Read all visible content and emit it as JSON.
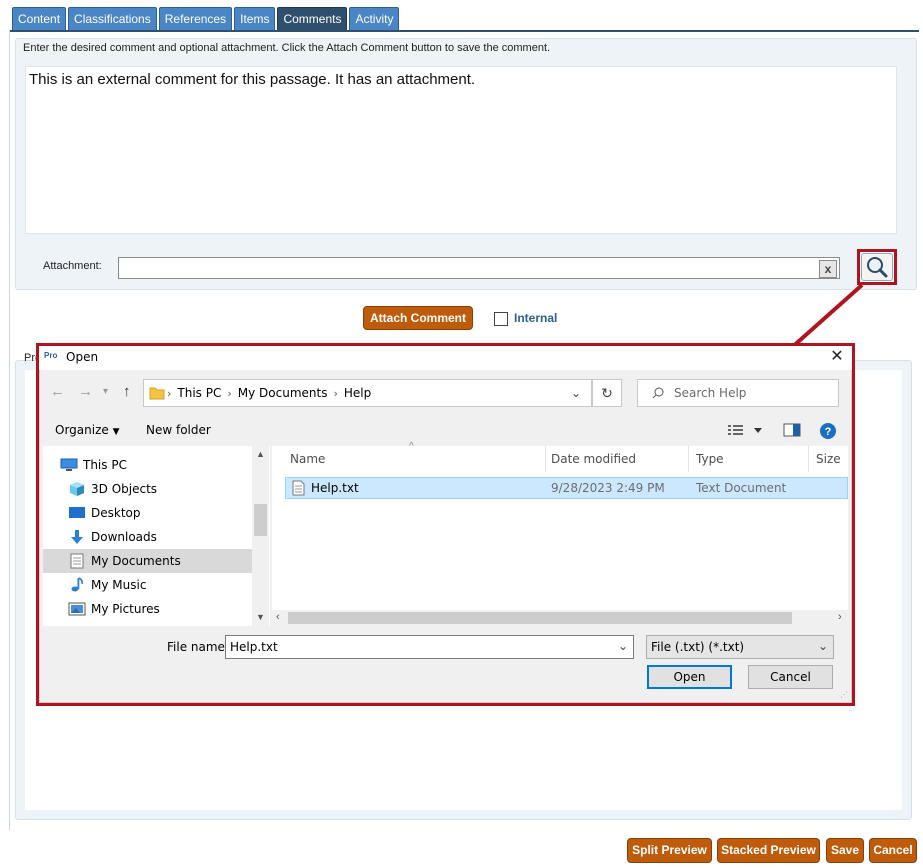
{
  "tabs": [
    {
      "label": "Content",
      "active": false
    },
    {
      "label": "Classifications",
      "active": false
    },
    {
      "label": "References",
      "active": false
    },
    {
      "label": "Items",
      "active": false
    },
    {
      "label": "Comments",
      "active": true
    },
    {
      "label": "Activity",
      "active": false
    }
  ],
  "comment_panel": {
    "instructions": "Enter the desired comment and optional attachment. Click the Attach Comment button to save the comment.",
    "comment_text": "This is an external comment for this passage.  It has an attachment.",
    "attachment_label": "Attachment:",
    "attachment_value": "",
    "clear_label": "x"
  },
  "actions": {
    "attach_comment": "Attach Comment",
    "internal_label": "Internal"
  },
  "preview": {
    "label": "Pre"
  },
  "dialog": {
    "title": "Open",
    "app_icon_text": "Pro",
    "close": "✕",
    "address": [
      "This PC",
      "My Documents",
      "Help"
    ],
    "search_placeholder": "Search Help",
    "toolbar": {
      "organize": "Organize",
      "new_folder": "New folder"
    },
    "nav_items": [
      {
        "label": "This PC",
        "icon": "computer-icon",
        "selected": false
      },
      {
        "label": "3D Objects",
        "icon": "cube-icon",
        "selected": false
      },
      {
        "label": "Desktop",
        "icon": "desktop-icon",
        "selected": false
      },
      {
        "label": "Downloads",
        "icon": "download-arrow-icon",
        "selected": false
      },
      {
        "label": "My Documents",
        "icon": "document-icon",
        "selected": true
      },
      {
        "label": "My Music",
        "icon": "music-note-icon",
        "selected": false
      },
      {
        "label": "My Pictures",
        "icon": "picture-icon",
        "selected": false
      }
    ],
    "columns": {
      "name": "Name",
      "date": "Date modified",
      "type": "Type",
      "size": "Size"
    },
    "files": [
      {
        "name": "Help.txt",
        "date": "9/28/2023 2:49 PM",
        "type": "Text Document"
      }
    ],
    "file_name_label": "File name:",
    "file_name_value": "Help.txt",
    "file_type": "File (.txt) (*.txt)",
    "open_button": "Open",
    "cancel_button": "Cancel"
  },
  "footer": {
    "split_preview": "Split Preview",
    "stacked_preview": "Stacked Preview",
    "save": "Save",
    "cancel": "Cancel"
  },
  "colors": {
    "tab_blue": "#4a86c5",
    "tab_active": "#2f4f6f",
    "orange_button": "#bf5c0b",
    "highlight_red": "#b0141e",
    "selection_blue": "#cce8ff"
  }
}
